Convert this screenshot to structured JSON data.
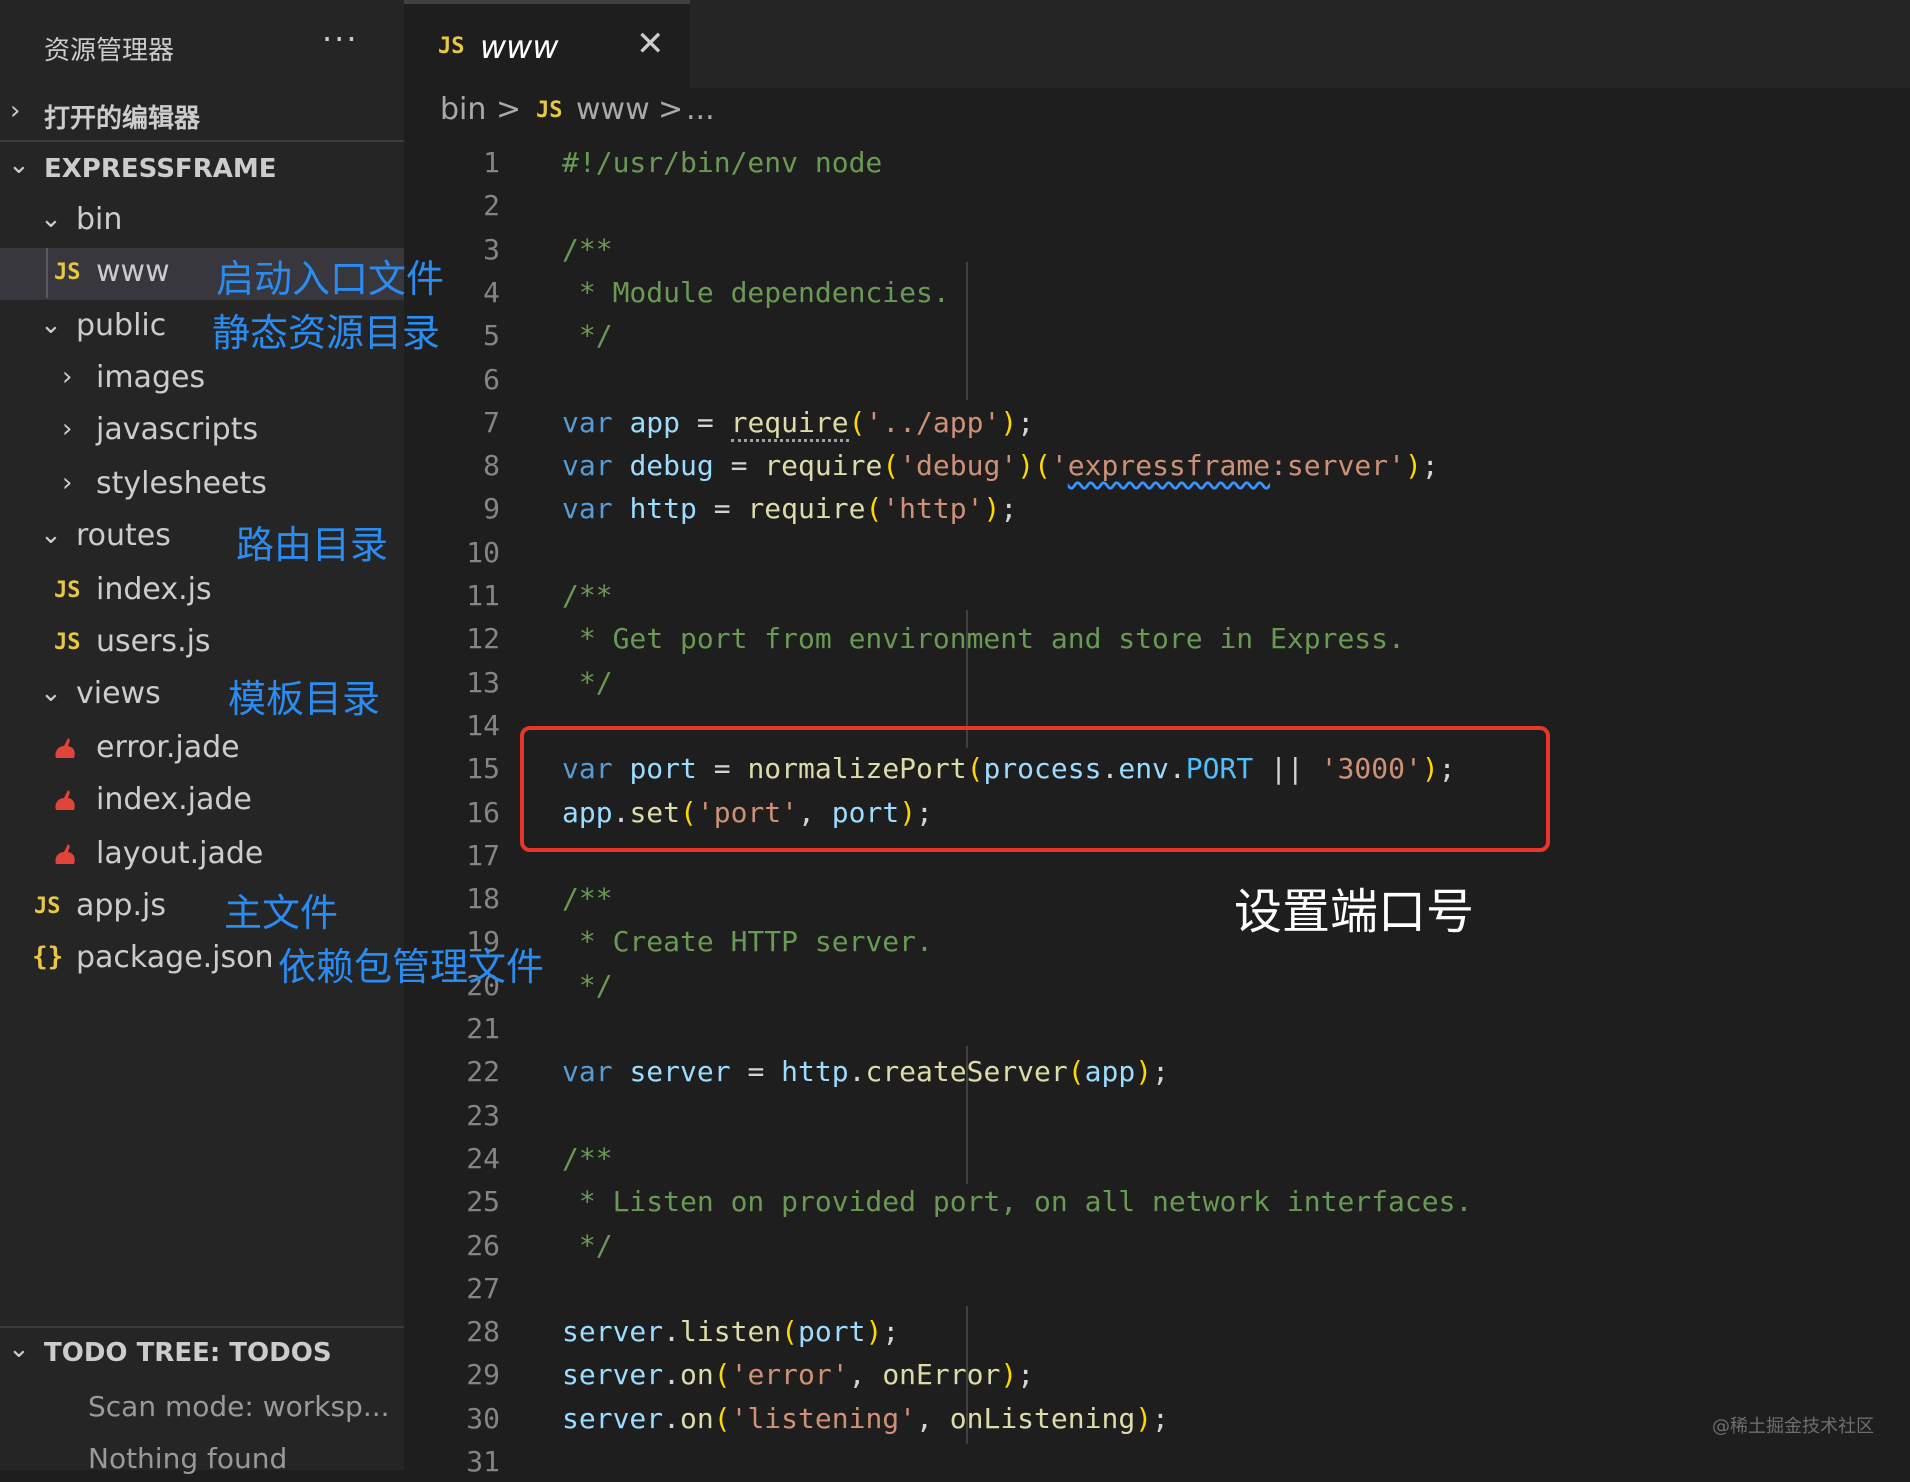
{
  "sidebar": {
    "title": "资源管理器",
    "more_label": "···",
    "open_editors_label": "打开的编辑器",
    "project_label": "EXPRESSFRAME",
    "todo_label": "TODO TREE: TODOS",
    "todo_scan": "Scan mode: worksp...",
    "todo_nothing": "Nothing found",
    "tree": {
      "bin": "bin",
      "www": "www",
      "public": "public",
      "images": "images",
      "javascripts": "javascripts",
      "stylesheets": "stylesheets",
      "routes": "routes",
      "index_js": "index.js",
      "users_js": "users.js",
      "views": "views",
      "error_jade": "error.jade",
      "index_jade": "index.jade",
      "layout_jade": "layout.jade",
      "app_js": "app.js",
      "package_json": "package.json"
    },
    "js_badge": "JS",
    "json_badge": "{}"
  },
  "annotations": {
    "www": "启动入口文件",
    "public": "静态资源目录",
    "routes": "路由目录",
    "views": "模板目录",
    "app": "主文件",
    "package": "依赖包管理文件",
    "box": "设置端口号"
  },
  "tab": {
    "badge": "JS",
    "name": "www",
    "close": "✕"
  },
  "breadcrumb": {
    "folder": "bin",
    "sep": ">",
    "badge": "JS",
    "file": "www",
    "more": "..."
  },
  "editor": {
    "line_numbers": [
      "1",
      "2",
      "3",
      "4",
      "5",
      "6",
      "7",
      "8",
      "9",
      "10",
      "11",
      "12",
      "13",
      "14",
      "15",
      "16",
      "17",
      "18",
      "19",
      "20",
      "21",
      "22",
      "23",
      "24",
      "25",
      "26",
      "27",
      "28",
      "29",
      "30",
      "31"
    ],
    "text": {
      "l1": "#!/usr/bin/env node",
      "l3": "/**",
      "l4": " * Module dependencies.",
      "l5": " */",
      "l11": "/**",
      "l12": " * Get port from environment and store in Express.",
      "l13": " */",
      "l18": "/**",
      "l19": " * Create HTTP server.",
      "l20": " */",
      "l24": "/**",
      "l25": " * Listen on provided port, on all network interfaces.",
      "l26": " */",
      "var": "var",
      "app": "app",
      "debug": "debug",
      "http": "http",
      "port": "port",
      "server": "server",
      "eq": " = ",
      "require": "require",
      "lp": "(",
      "rp": ")",
      "semi": ";",
      "str_app": "'../app'",
      "str_debug": "'debug'",
      "str_q": "'",
      "str_expressframe": "expressframe",
      "str_server_tail": ":server'",
      "str_http": "'http'",
      "normalizePort": "normalizePort",
      "process": "process",
      "dot": ".",
      "env": "env",
      "PORT": "PORT",
      "or": " || ",
      "str_3000": "'3000'",
      "set": "set",
      "str_port": "'port'",
      "comma": ", ",
      "createServer": "createServer",
      "listen": "listen",
      "on": "on",
      "str_error": "'error'",
      "onError": "onError",
      "str_listening": "'listening'",
      "onListening": "onListening"
    }
  },
  "watermark": "@稀土掘金技术社区"
}
